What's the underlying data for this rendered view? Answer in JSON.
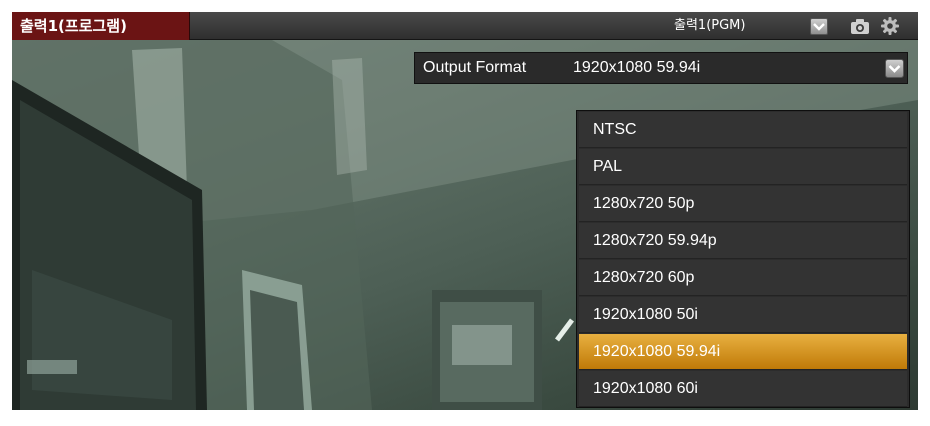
{
  "header": {
    "title": "출력1(프로그램)",
    "source_selected": "출력1(PGM)",
    "icons": [
      "chevron-down-icon",
      "camera-icon",
      "gear-icon"
    ]
  },
  "format": {
    "label": "Output Format",
    "selected": "1920x1080 59.94i"
  },
  "dropdown": {
    "options": [
      {
        "label": "NTSC"
      },
      {
        "label": "PAL"
      },
      {
        "label": "1280x720 50p"
      },
      {
        "label": "1280x720 59.94p"
      },
      {
        "label": "1280x720 60p"
      },
      {
        "label": "1920x1080 50i"
      },
      {
        "label": "1920x1080 59.94i",
        "selected": true
      },
      {
        "label": "1920x1080 60i"
      }
    ],
    "highlight_color": "#d9961f"
  },
  "colors": {
    "title_tab": "#6b1414",
    "panel": "#1b1b1b"
  }
}
